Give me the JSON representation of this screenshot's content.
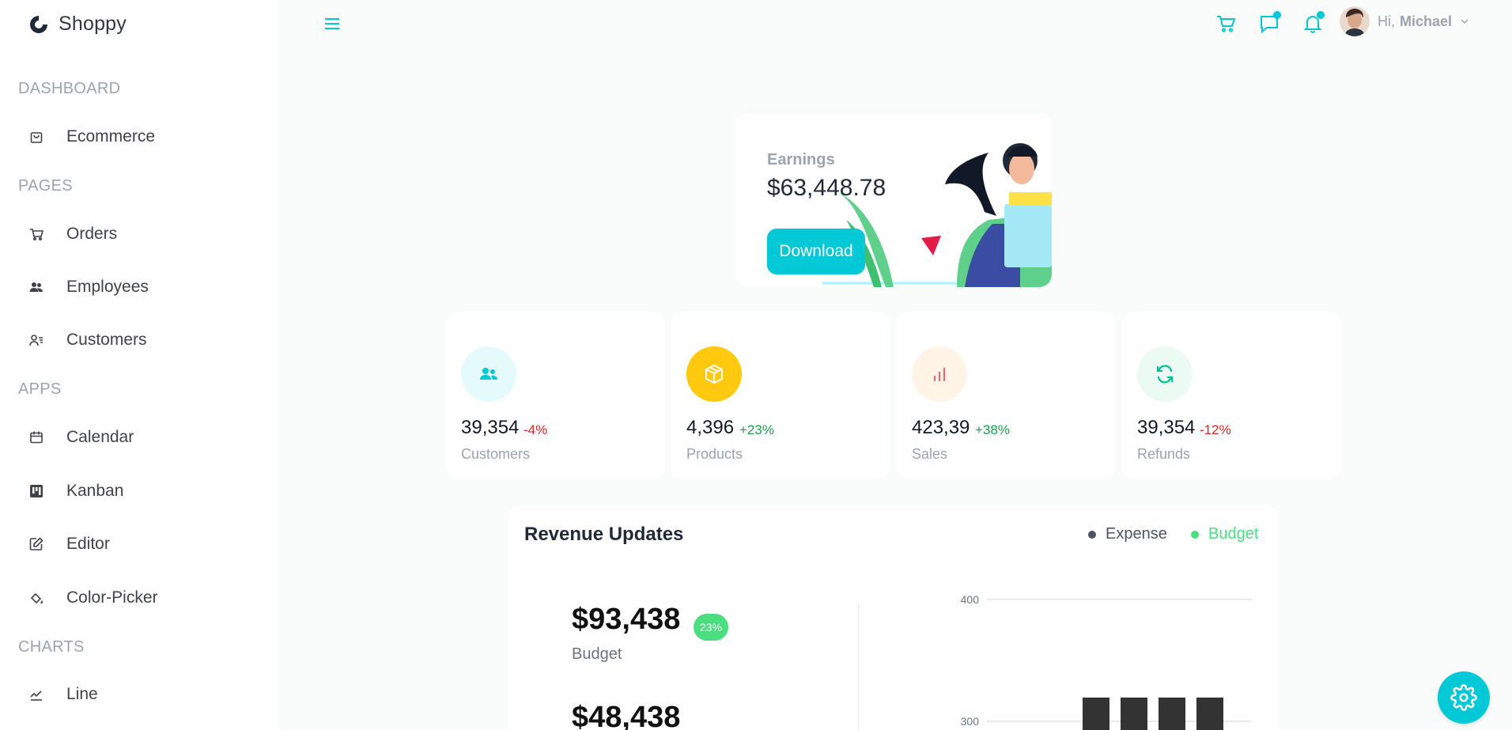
{
  "brand": {
    "name": "Shoppy"
  },
  "sidebar": {
    "sections": [
      {
        "title": "DASHBOARD",
        "items": [
          {
            "label": "Ecommerce",
            "icon": "shopping-bag-icon"
          }
        ]
      },
      {
        "title": "PAGES",
        "items": [
          {
            "label": "Orders",
            "icon": "cart-icon"
          },
          {
            "label": "Employees",
            "icon": "employees-icon"
          },
          {
            "label": "Customers",
            "icon": "customers-icon"
          }
        ]
      },
      {
        "title": "APPS",
        "items": [
          {
            "label": "Calendar",
            "icon": "calendar-icon"
          },
          {
            "label": "Kanban",
            "icon": "kanban-icon"
          },
          {
            "label": "Editor",
            "icon": "edit-icon"
          },
          {
            "label": "Color-Picker",
            "icon": "paint-bucket-icon"
          }
        ]
      },
      {
        "title": "CHARTS",
        "items": [
          {
            "label": "Line",
            "icon": "line-chart-icon"
          }
        ]
      }
    ]
  },
  "header": {
    "greeting": "Hi,",
    "username": "Michael"
  },
  "earnings": {
    "label": "Earnings",
    "value": "$63,448.78",
    "button": "Download"
  },
  "stats": [
    {
      "value": "39,354",
      "change": "-4%",
      "change_color": "#dc2626",
      "title": "Customers",
      "icon": "customers-group-icon",
      "icon_bg": "#e5fafb",
      "icon_color": "#03c9d7"
    },
    {
      "value": "4,396",
      "change": "+23%",
      "change_color": "#16a34a",
      "title": "Products",
      "icon": "box-icon",
      "icon_bg": "#fec90f",
      "icon_color": "#ffffff"
    },
    {
      "value": "423,39",
      "change": "+38%",
      "change_color": "#16a34a",
      "title": "Sales",
      "icon": "bar-chart-icon",
      "icon_bg": "#fff4e5",
      "icon_color": "#e46a76"
    },
    {
      "value": "39,354",
      "change": "-12%",
      "change_color": "#dc2626",
      "title": "Refunds",
      "icon": "refresh-icon",
      "icon_bg": "#ebfaf2",
      "icon_color": "#00c292"
    }
  ],
  "revenue": {
    "title": "Revenue Updates",
    "legend": [
      {
        "label": "Expense",
        "color": "#4b5563"
      },
      {
        "label": "Budget",
        "color": "#4ade80"
      }
    ],
    "budget_value": "$93,438",
    "budget_badge": "23%",
    "budget_label": "Budget",
    "expense_value": "$48,438"
  },
  "chart_data": {
    "type": "bar",
    "y_ticks": [
      400,
      300
    ],
    "ylim": [
      0,
      400
    ],
    "values": [
      300,
      300,
      300,
      300
    ],
    "bar_color": "#333333"
  },
  "colors": {
    "accent": "#03c9d7"
  }
}
